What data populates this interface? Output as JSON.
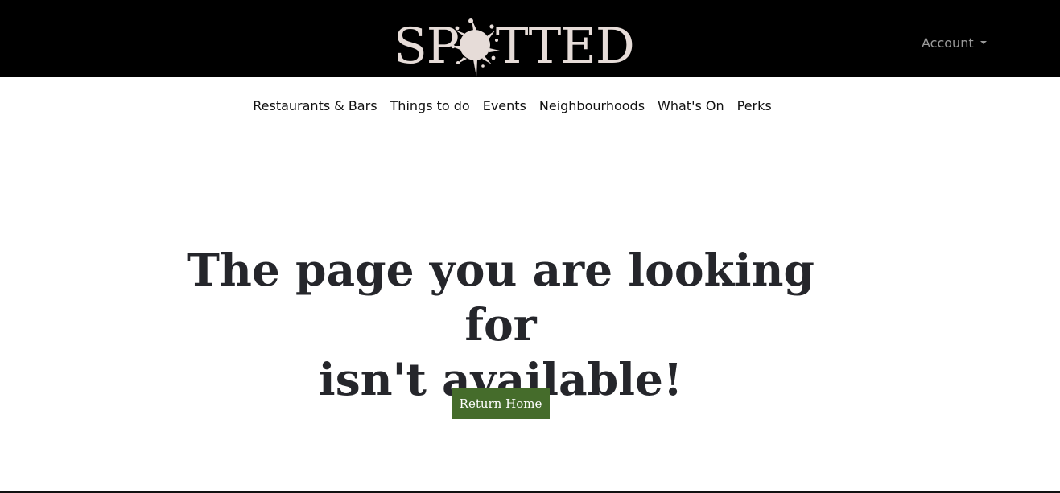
{
  "header": {
    "logo_text": "SPOTTED",
    "logo_left": "SP",
    "logo_right": "TTED",
    "account_label": "Account"
  },
  "nav": {
    "items": [
      {
        "label": "Restaurants & Bars"
      },
      {
        "label": "Things to do"
      },
      {
        "label": "Events"
      },
      {
        "label": "Neighbourhoods"
      },
      {
        "label": "What's On"
      },
      {
        "label": "Perks"
      }
    ]
  },
  "main": {
    "headline_line1": "The page you are looking for",
    "headline_line2": "isn't available!",
    "return_label": "Return Home"
  },
  "colors": {
    "header_bg": "#000000",
    "logo": "#e6dcd8",
    "button_bg": "#456c2b",
    "headline": "#25262b"
  },
  "icons": {
    "splat": "ink-splat-icon",
    "caret": "caret-down-icon"
  }
}
